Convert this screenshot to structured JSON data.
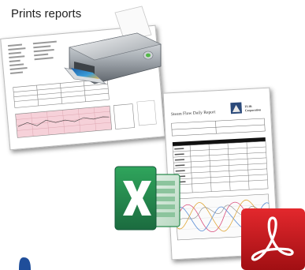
{
  "caption": "Prints reports",
  "report_front": {
    "title": "Steam Flow Daily Report",
    "company": "FLIR\nCorporation"
  },
  "colors": {
    "excel_green": "#1e7145",
    "excel_light": "#2fa55c",
    "pdf_red": "#c4171b",
    "chart_pink": "#f4c6cf",
    "printer_gray": "#8a8f95"
  },
  "icons": [
    "printer-icon",
    "excel-icon",
    "pdf-icon"
  ]
}
